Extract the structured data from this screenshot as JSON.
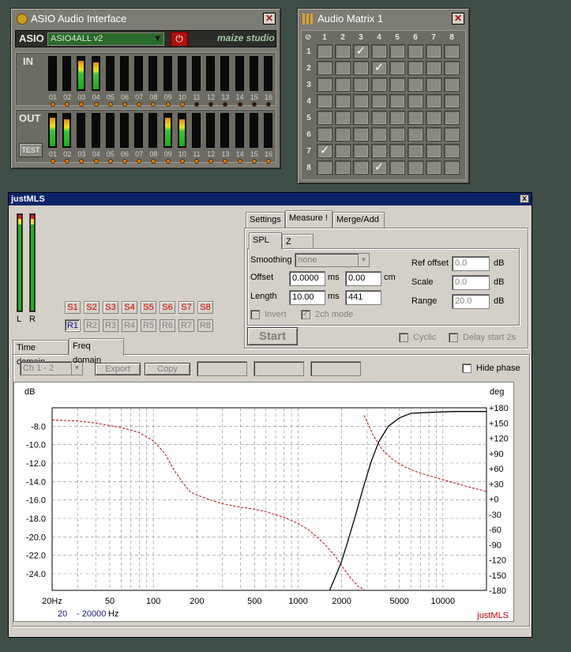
{
  "asio": {
    "title": "ASIO Audio Interface",
    "label": "ASIO",
    "driver": "ASIO4ALL v2",
    "brand": "maize studio",
    "in_label": "IN",
    "out_label": "OUT",
    "test_label": "TEST",
    "channels": [
      "01",
      "02",
      "03",
      "04",
      "05",
      "06",
      "07",
      "08",
      "09",
      "10",
      "11",
      "12",
      "13",
      "14",
      "15",
      "16"
    ],
    "in_levels": [
      0,
      0,
      0.85,
      0.8,
      0,
      0,
      0,
      0,
      0,
      0,
      0,
      0,
      0,
      0,
      0,
      0
    ],
    "in_leds": [
      1,
      1,
      1,
      1,
      1,
      1,
      1,
      1,
      1,
      1,
      0,
      0,
      0,
      0,
      0,
      0
    ],
    "out_levels": [
      0.85,
      0.8,
      0,
      0,
      0,
      0,
      0,
      0,
      0.85,
      0.8,
      0,
      0,
      0,
      0,
      0,
      0
    ],
    "out_leds": [
      1,
      1,
      1,
      1,
      1,
      1,
      1,
      1,
      1,
      1,
      1,
      1,
      1,
      1,
      1,
      1
    ]
  },
  "matrix": {
    "title": "Audio Matrix 1",
    "cols": [
      "1",
      "2",
      "3",
      "4",
      "5",
      "6",
      "7",
      "8"
    ],
    "rows": [
      "1",
      "2",
      "3",
      "4",
      "5",
      "6",
      "7",
      "8"
    ],
    "checked": [
      [
        1,
        3
      ],
      [
        2,
        4
      ],
      [
        7,
        1
      ],
      [
        8,
        4
      ]
    ],
    "check_glyph": "✓"
  },
  "justmls": {
    "title": "justMLS",
    "close": "x",
    "meter_l": "L",
    "meter_r": "R",
    "s_buttons": [
      "S1",
      "S2",
      "S3",
      "S4",
      "S5",
      "S6",
      "S7",
      "S8"
    ],
    "r_buttons": [
      "R1",
      "R2",
      "R3",
      "R4",
      "R5",
      "R6",
      "R7",
      "R8"
    ],
    "tabs_top": [
      "Settings",
      "Measure !",
      "Merge/Add"
    ],
    "subtabs": [
      "SPL",
      "Z"
    ],
    "smoothing_label": "Smoothing",
    "smoothing_value": "none",
    "offset_label": "Offset",
    "offset_ms": "0.0000",
    "offset_cm": "0.00",
    "unit_ms": "ms",
    "unit_cm": "cm",
    "length_label": "Length",
    "length_ms": "10.00",
    "length_samples": "441",
    "invert_label": "Invert",
    "twoch_label": "2ch mode",
    "refoffset_label": "Ref offset",
    "refoffset_value": "0.0",
    "scale_label": "Scale",
    "scale_value": "0.0",
    "range_label": "Range",
    "range_value": "20.0",
    "unit_db": "dB",
    "start_label": "Start",
    "cyclic_label": "Cyclic",
    "delay_label": "Delay start 2s",
    "domain_tabs": [
      "Time domain",
      "Freq domain"
    ],
    "channel_select": "Ch 1 - 2",
    "export_label": "Export",
    "copy_label": "Copy",
    "hide_phase_label": "Hide phase",
    "freq_from": "20",
    "freq_to": "- 20000",
    "freq_unit": "Hz",
    "watermark": "justMLS"
  },
  "chart_data": {
    "type": "line",
    "ylabel_left": "dB",
    "ylabel_right": "deg",
    "x_ticks": [
      "20Hz",
      "50",
      "100",
      "200",
      "500",
      "1000",
      "2000",
      "5000",
      "10000"
    ],
    "x_tick_values": [
      20,
      50,
      100,
      200,
      500,
      1000,
      2000,
      5000,
      10000
    ],
    "xlim": [
      20,
      20000
    ],
    "x_scale": "log",
    "y_left_ticks": [
      "-8.0",
      "-10.0",
      "-12.0",
      "-14.0",
      "-16.0",
      "-18.0",
      "-20.0",
      "-22.0",
      "-24.0"
    ],
    "y_left_values": [
      -8,
      -10,
      -12,
      -14,
      -16,
      -18,
      -20,
      -22,
      -24
    ],
    "ylim_left": [
      -25.8,
      -6.0
    ],
    "y_right_ticks": [
      "+180",
      "+150",
      "+120",
      "+90",
      "+60",
      "+30",
      "+0",
      "-30",
      "-60",
      "-90",
      "-120",
      "-150",
      "-180"
    ],
    "y_right_values": [
      180,
      150,
      120,
      90,
      60,
      30,
      0,
      -30,
      -60,
      -90,
      -120,
      -150,
      -180
    ],
    "ylim_right": [
      -180,
      180
    ],
    "grid": true,
    "series": [
      {
        "axis": "left",
        "color": "#000000",
        "style": "solid",
        "x": [
          1650,
          1800,
          2000,
          2200,
          2500,
          2800,
          3200,
          3600,
          4200,
          5000,
          6000,
          8000,
          12000,
          20000
        ],
        "y": [
          -25.8,
          -24.4,
          -22.6,
          -20.5,
          -17.6,
          -14.8,
          -11.8,
          -9.7,
          -8.0,
          -7.1,
          -6.6,
          -6.5,
          -6.4,
          -6.4
        ]
      },
      {
        "axis": "right",
        "color": "#c00000",
        "style": "dashed",
        "x": [
          20,
          30,
          40,
          50,
          60,
          70,
          80,
          100,
          120,
          140,
          160,
          180,
          200,
          250,
          300,
          400,
          500,
          600,
          800,
          1000,
          1200,
          1500,
          1800,
          2000,
          2300,
          2600,
          2900
        ],
        "y": [
          156,
          154,
          150,
          145,
          141,
          136,
          131,
          115,
          90,
          56,
          32,
          14,
          8,
          -2,
          -9,
          -16,
          -20,
          -25,
          -36,
          -48,
          -62,
          -87,
          -112,
          -132,
          -155,
          -172,
          -180
        ]
      },
      {
        "axis": "right",
        "color": "#c00000",
        "style": "dashed",
        "x": [
          2850,
          3000,
          3300,
          3800,
          4500,
          5500,
          7000,
          9000,
          12000,
          16000,
          20000
        ],
        "y": [
          165,
          152,
          126,
          98,
          78,
          63,
          51,
          42,
          32,
          22,
          15
        ]
      }
    ]
  }
}
